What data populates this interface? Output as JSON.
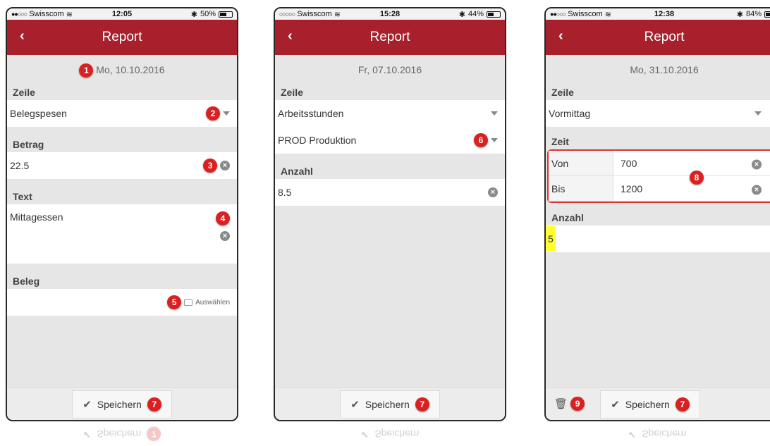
{
  "phones": [
    {
      "status": {
        "carrier": "Swisscom",
        "time": "12:05",
        "battery": "50%",
        "battery_level": 0.5
      },
      "nav": {
        "title": "Report"
      },
      "date": "Mo, 10.10.2016",
      "badges": {
        "date": "1",
        "zeile": "2",
        "betrag": "3",
        "text": "4",
        "beleg": "5",
        "save": "7"
      },
      "zeile_label": "Zeile",
      "zeile_value": "Belegspesen",
      "betrag_label": "Betrag",
      "betrag_value": "22.5",
      "text_label": "Text",
      "text_value": "Mittagessen",
      "beleg_label": "Beleg",
      "beleg_button": "Auswählen",
      "save_label": "Speichern"
    },
    {
      "status": {
        "carrier": "Swisscom",
        "time": "15:28",
        "battery": "44%",
        "battery_level": 0.44
      },
      "nav": {
        "title": "Report"
      },
      "date": "Fr, 07.10.2016",
      "badges": {
        "prod": "6",
        "save": "7"
      },
      "zeile_label": "Zeile",
      "zeile_value": "Arbeitsstunden",
      "prod_value": "PROD Produktion",
      "anzahl_label": "Anzahl",
      "anzahl_value": "8.5",
      "save_label": "Speichern"
    },
    {
      "status": {
        "carrier": "Swisscom",
        "time": "12:38",
        "battery": "84%",
        "battery_level": 0.84
      },
      "nav": {
        "title": "Report"
      },
      "date": "Mo, 31.10.2016",
      "badges": {
        "zeit": "8",
        "delete": "9",
        "save": "7"
      },
      "zeile_label": "Zeile",
      "zeile_value": "Vormittag",
      "zeit_label": "Zeit",
      "von_label": "Von",
      "von_value": "700",
      "bis_label": "Bis",
      "bis_value": "1200",
      "anzahl_label": "Anzahl",
      "anzahl_value": "5",
      "save_label": "Speichern"
    }
  ],
  "colors": {
    "navbar": "#a8202c",
    "badge": "#d92121",
    "highlight": "#ffff33"
  },
  "icons": {
    "back": "chevron-left-icon",
    "clear": "clear-icon",
    "dropdown": "caret-down-icon",
    "check": "check-icon",
    "trash": "trash-icon",
    "folder": "folder-icon"
  }
}
